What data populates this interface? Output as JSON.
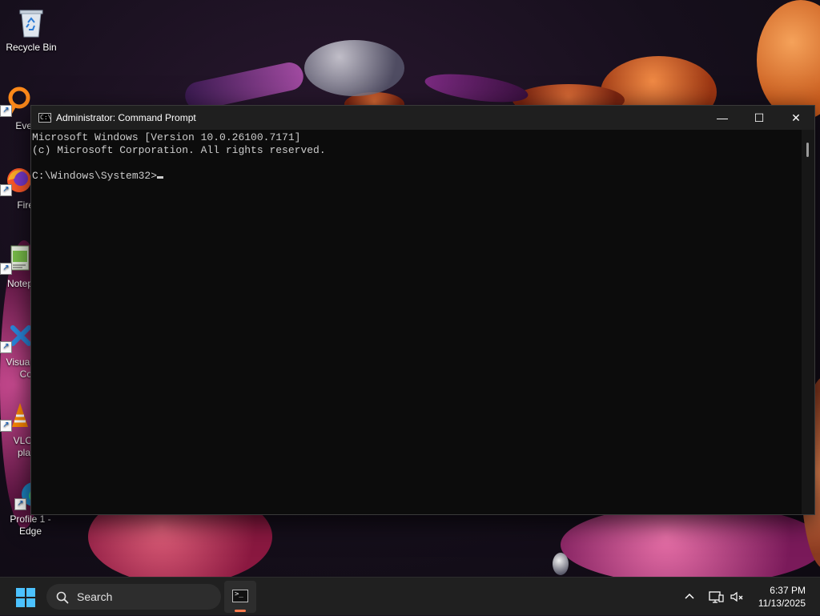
{
  "desktop": {
    "icons": [
      {
        "label": "Recycle Bin"
      },
      {
        "label": "Every"
      },
      {
        "label": "Fire"
      },
      {
        "label": "Notep"
      },
      {
        "label": "Visual",
        "label2": "Co"
      },
      {
        "label": "VLC",
        "label2": "pla"
      },
      {
        "label": "Profile 1 -",
        "label2": "Edge"
      }
    ]
  },
  "window": {
    "title": "Administrator: Command Prompt",
    "app_icon": "C:\\",
    "buttons": {
      "minimize": "—",
      "maximize": "☐",
      "close": "✕"
    },
    "console_lines": [
      "Microsoft Windows [Version 10.0.26100.7171]",
      "(c) Microsoft Corporation. All rights reserved.",
      "",
      "C:\\Windows\\System32>"
    ]
  },
  "taskbar": {
    "search_label": "Search",
    "pinned": [
      {
        "name": "Command Prompt"
      }
    ],
    "clock": {
      "time": "6:37 PM",
      "date": "11/13/2025"
    }
  },
  "colors": {
    "accent": "#4cc2ff",
    "console_bg": "#0c0c0c",
    "console_fg": "#cccccc",
    "taskbar_bg": "#202020",
    "active_indicator": "#ff7a4d"
  }
}
